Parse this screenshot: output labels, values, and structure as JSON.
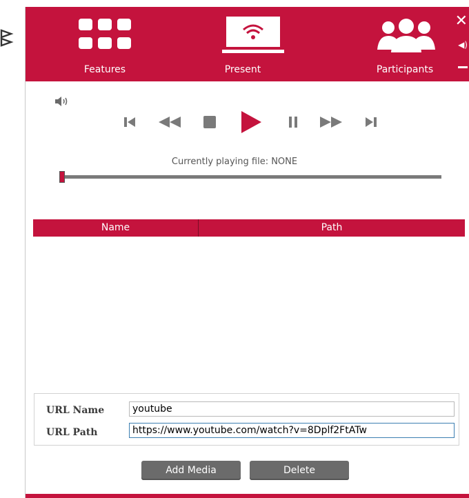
{
  "app": {
    "logo_icon": "va-logo-icon",
    "accent": "#c4133d"
  },
  "header": {
    "nav": [
      {
        "label": "Features",
        "icon": "grid-icon"
      },
      {
        "label": "Present",
        "icon": "present-screen-icon"
      },
      {
        "label": "Participants",
        "icon": "people-icon"
      }
    ],
    "controls": {
      "close": "✕",
      "volume": "speaker-icon",
      "minimize": "minimize-icon"
    }
  },
  "player": {
    "volume_icon": "speaker-icon",
    "transport": [
      "skip-start-icon",
      "rewind-icon",
      "stop-icon",
      "play-icon",
      "pause-icon",
      "fast-forward-icon",
      "skip-end-icon"
    ],
    "now_playing": "Currently playing file: NONE",
    "seek_position": 0
  },
  "media_table": {
    "columns": [
      "Name",
      "Path"
    ],
    "rows": []
  },
  "url_form": {
    "name_label": "URL Name",
    "name_value": "youtube",
    "path_label": "URL Path",
    "path_value": "https://www.youtube.com/watch?v=8Dplf2FtATw"
  },
  "actions": {
    "add": "Add Media",
    "delete": "Delete"
  }
}
